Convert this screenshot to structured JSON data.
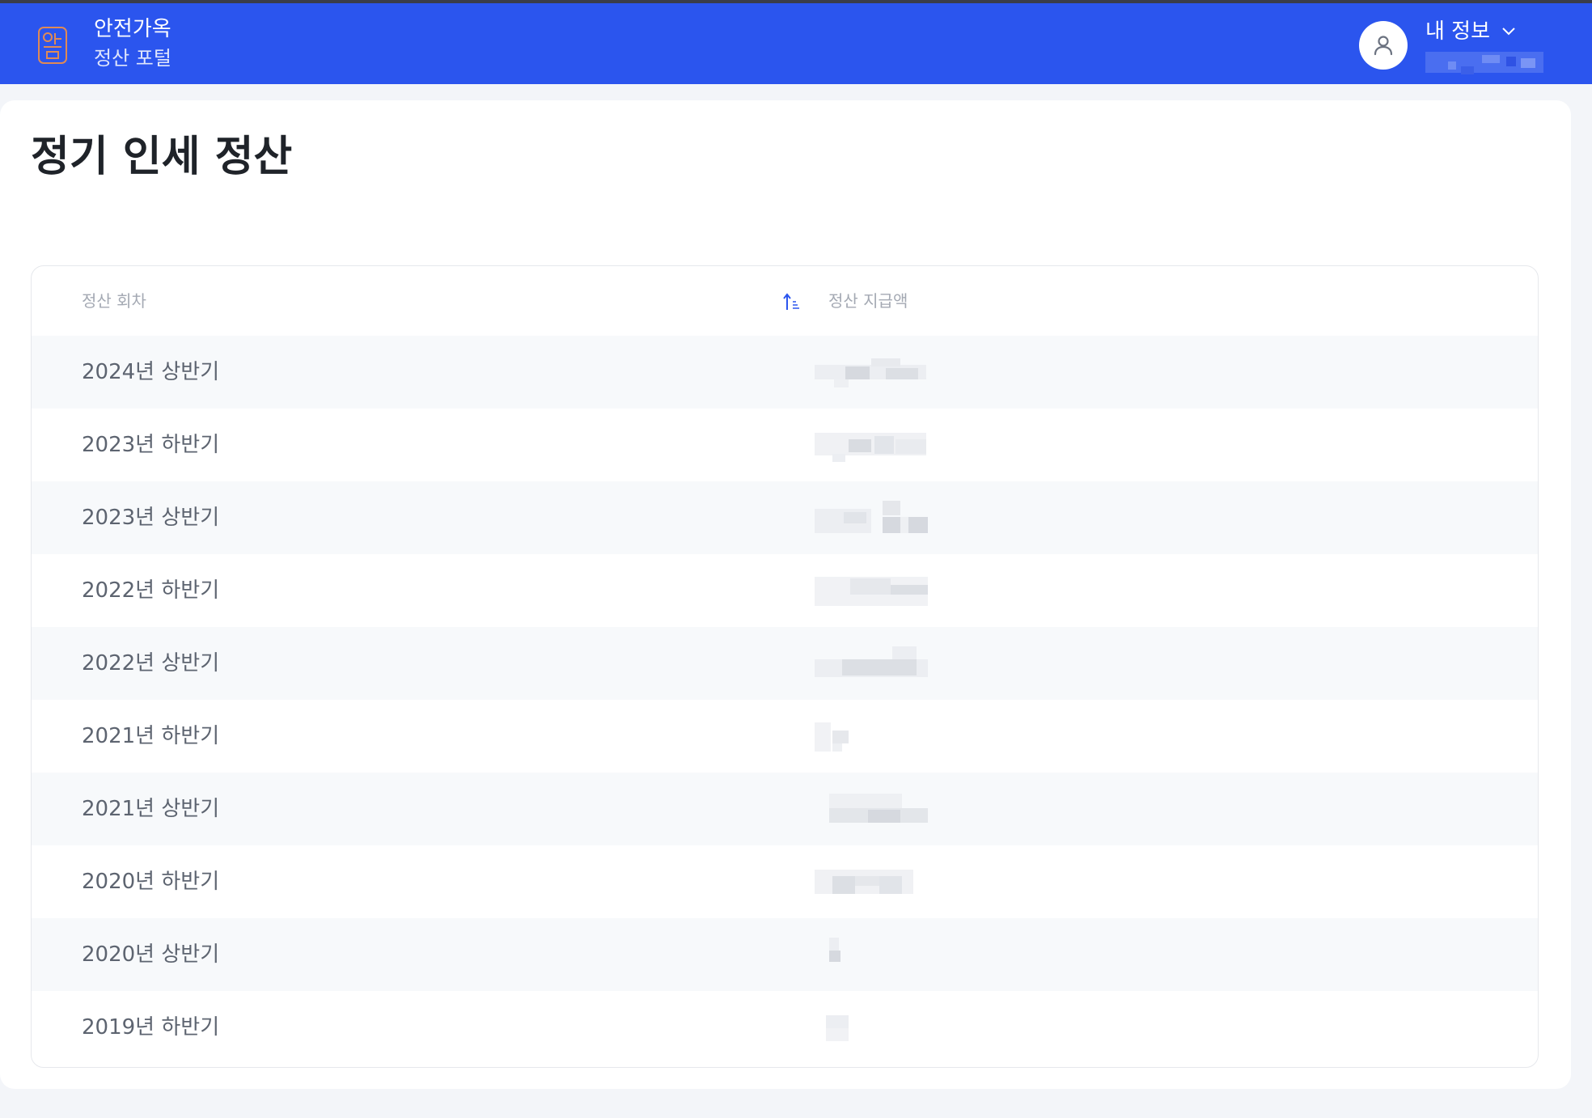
{
  "header": {
    "brand_name": "안전가옥",
    "brand_sub": "정산 포털",
    "user_menu_label": "내 정보",
    "colors": {
      "bar": "#2b55ee",
      "logo": "#e08a55"
    }
  },
  "page": {
    "title": "정기 인세 정산"
  },
  "table": {
    "columns": {
      "round": "정산 회차",
      "amount": "정산 지급액"
    },
    "rows": [
      {
        "round": "2024년 상반기"
      },
      {
        "round": "2023년 하반기"
      },
      {
        "round": "2023년 상반기"
      },
      {
        "round": "2022년 하반기"
      },
      {
        "round": "2022년 상반기"
      },
      {
        "round": "2021년 하반기"
      },
      {
        "round": "2021년 상반기"
      },
      {
        "round": "2020년 하반기"
      },
      {
        "round": "2020년 상반기"
      },
      {
        "round": "2019년 하반기"
      }
    ]
  }
}
